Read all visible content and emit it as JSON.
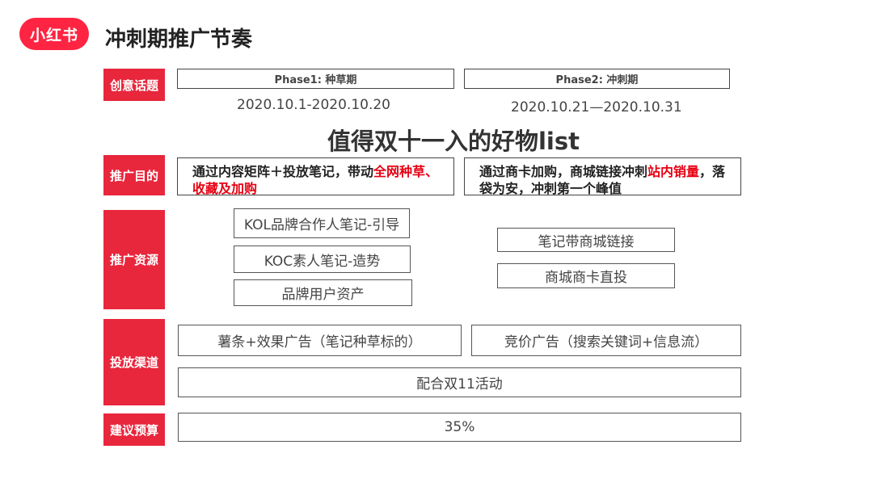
{
  "header": {
    "logo_text": "小红书",
    "title": "冲刺期推广节奏"
  },
  "phases": [
    {
      "label": "Phase1: 种草期",
      "dates": "2020.10.1-2020.10.20"
    },
    {
      "label": "Phase2: 冲刺期",
      "dates": "2020.10.21—2020.10.31"
    }
  ],
  "row_labels": {
    "topic": "创意话题",
    "goal": "推广目的",
    "resources": "推广资源",
    "channels": "投放渠道",
    "budget": "建议预算"
  },
  "topic_title": "值得双十一入的好物list",
  "goals": {
    "phase1": {
      "text": "通过内容矩阵＋投放笔记，带动",
      "highlight": "全网种草、收藏及加购"
    },
    "phase2": {
      "text_before": "通过商卡加购，商城链接冲刺",
      "highlight": "站内销量",
      "text_after": "，落袋为安，冲刺第一个峰值"
    }
  },
  "resources": {
    "phase1": [
      "KOL品牌合作人笔记-引导",
      "KOC素人笔记-造势",
      "品牌用户资产"
    ],
    "phase2": [
      "笔记带商城链接",
      "商城商卡直投"
    ]
  },
  "channels": {
    "phase1": "薯条+效果广告（笔记种草标的）",
    "phase2": "竞价广告（搜索关键词+信息流）",
    "shared": "配合双11活动"
  },
  "budget": "35%"
}
